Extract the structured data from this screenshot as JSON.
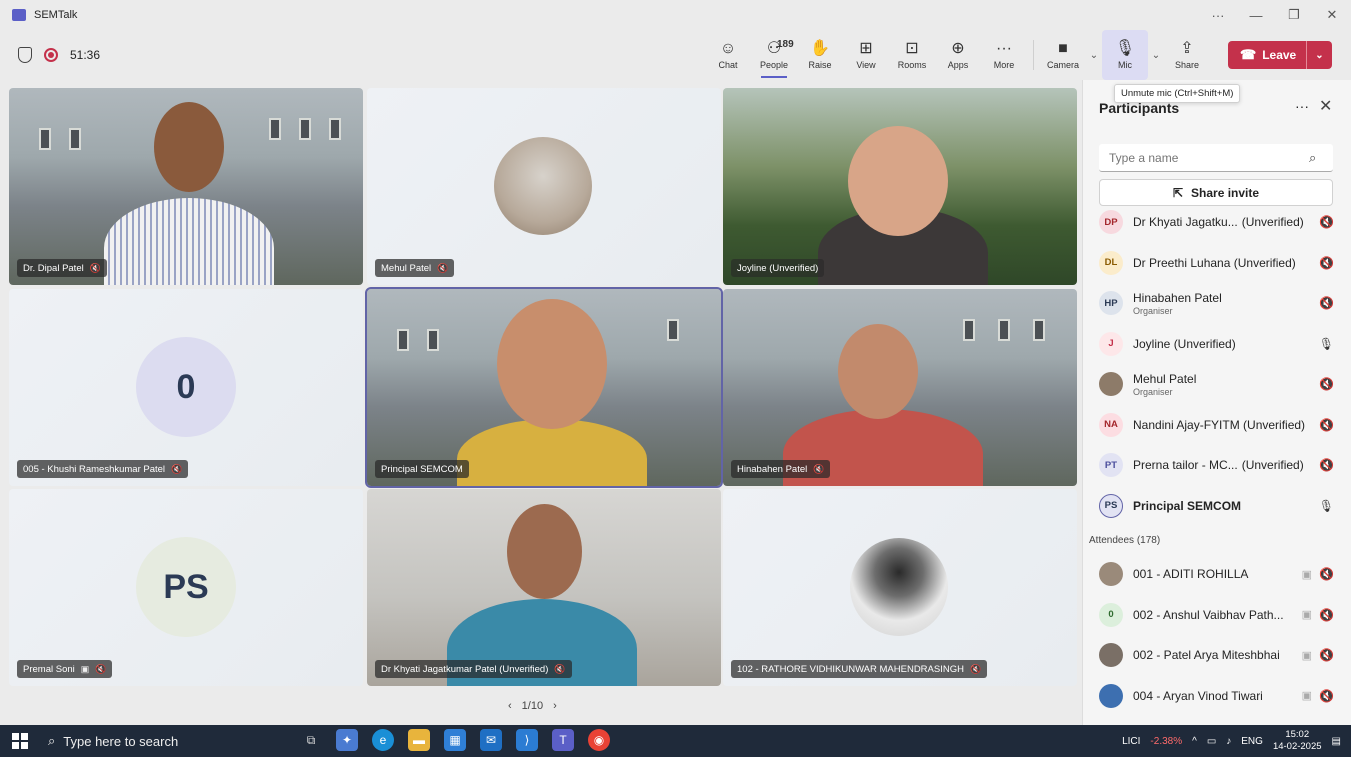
{
  "window": {
    "title": "SEMTalk",
    "controls": [
      "···",
      "—",
      "❐",
      "✕"
    ]
  },
  "meeting": {
    "timer": "51:36"
  },
  "toolbar": {
    "chat": "Chat",
    "people": "People",
    "people_count": "189",
    "raise": "Raise",
    "view": "View",
    "rooms": "Rooms",
    "apps": "Apps",
    "more": "More",
    "camera": "Camera",
    "mic": "Mic",
    "share": "Share",
    "leave": "Leave"
  },
  "tooltip": "Unmute mic (Ctrl+Shift+M)",
  "tiles": [
    {
      "name": "Dr. Dipal Patel",
      "muted": true
    },
    {
      "name": "Mehul Patel",
      "muted": true
    },
    {
      "name": "Joyline (Unverified)",
      "muted": false
    },
    {
      "name": "005 - Khushi Rameshkumar Patel",
      "muted": true,
      "initials": "0"
    },
    {
      "name": "Principal SEMCOM",
      "muted": false
    },
    {
      "name": "Hinabahen Patel",
      "muted": true
    },
    {
      "name": "Premal Soni",
      "muted": true,
      "initials": "PS"
    },
    {
      "name": "Dr Khyati Jagatkumar Patel (Unverified)",
      "muted": true
    },
    {
      "name": "102 - RATHORE VIDHIKUNWAR MAHENDRASINGH",
      "muted": true
    }
  ],
  "pager": {
    "prev": "‹",
    "label": "1/10",
    "next": "›"
  },
  "panel": {
    "title": "Participants",
    "search_placeholder": "Type a name",
    "share_invite": "Share invite",
    "participants": [
      {
        "initials": "DP",
        "name": "Dr Khyati Jagatku...",
        "suffix": "(Unverified)",
        "role": "",
        "mic": "muted",
        "color": "#f7d9df",
        "fg": "#a4262c"
      },
      {
        "initials": "DL",
        "name": "Dr Preethi Luhana (Unverified)",
        "suffix": "",
        "role": "",
        "mic": "muted",
        "color": "#fbeccb",
        "fg": "#8a5a00"
      },
      {
        "initials": "HP",
        "name": "Hinabahen Patel",
        "suffix": "",
        "role": "Organiser",
        "mic": "muted",
        "color": "#dde3ec",
        "fg": "#2b3a55"
      },
      {
        "initials": "J",
        "name": "Joyline (Unverified)",
        "suffix": "",
        "role": "",
        "mic": "on",
        "color": "#fde7e9",
        "fg": "#c4314b"
      },
      {
        "initials": "",
        "name": "Mehul Patel",
        "suffix": "",
        "role": "Organiser",
        "mic": "muted",
        "color": "#8d7b69",
        "fg": "#fff"
      },
      {
        "initials": "NA",
        "name": "Nandini Ajay-FYITM (Unverified)",
        "suffix": "",
        "role": "",
        "mic": "muted",
        "color": "#fcdde2",
        "fg": "#a4262c"
      },
      {
        "initials": "PT",
        "name": "Prerna tailor - MC...",
        "suffix": "(Unverified)",
        "role": "",
        "mic": "muted",
        "color": "#e2e3f3",
        "fg": "#4b4e9c"
      },
      {
        "initials": "PS",
        "name": "Principal SEMCOM",
        "suffix": "",
        "role": "",
        "mic": "on",
        "color": "#e2e3f3",
        "fg": "#2b3a55",
        "bold": true
      }
    ],
    "attendees_header": "Attendees (178)",
    "attendees": [
      {
        "initials": "",
        "name": "001 - ADITI ROHILLA",
        "color": "#9a8a7a",
        "fg": "#fff"
      },
      {
        "initials": "0",
        "name": "002 - Anshul Vaibhav Path...",
        "color": "#dcefdc",
        "fg": "#2f6b2f"
      },
      {
        "initials": "",
        "name": "002 - Patel Arya Miteshbhai",
        "color": "#7a6f66",
        "fg": "#fff"
      },
      {
        "initials": "",
        "name": "004 - Aryan Vinod Tiwari",
        "color": "#3d6fb0",
        "fg": "#fff"
      }
    ]
  },
  "taskbar": {
    "search_placeholder": "Type here to search",
    "stock_name": "LICI",
    "stock_change": "-2.38%",
    "lang": "ENG",
    "time": "15:02",
    "date": "14-02-2025"
  },
  "colors": {
    "accent": "#5b5fc7",
    "leave": "#c4314b",
    "taskbar": "#1f2a3a"
  }
}
